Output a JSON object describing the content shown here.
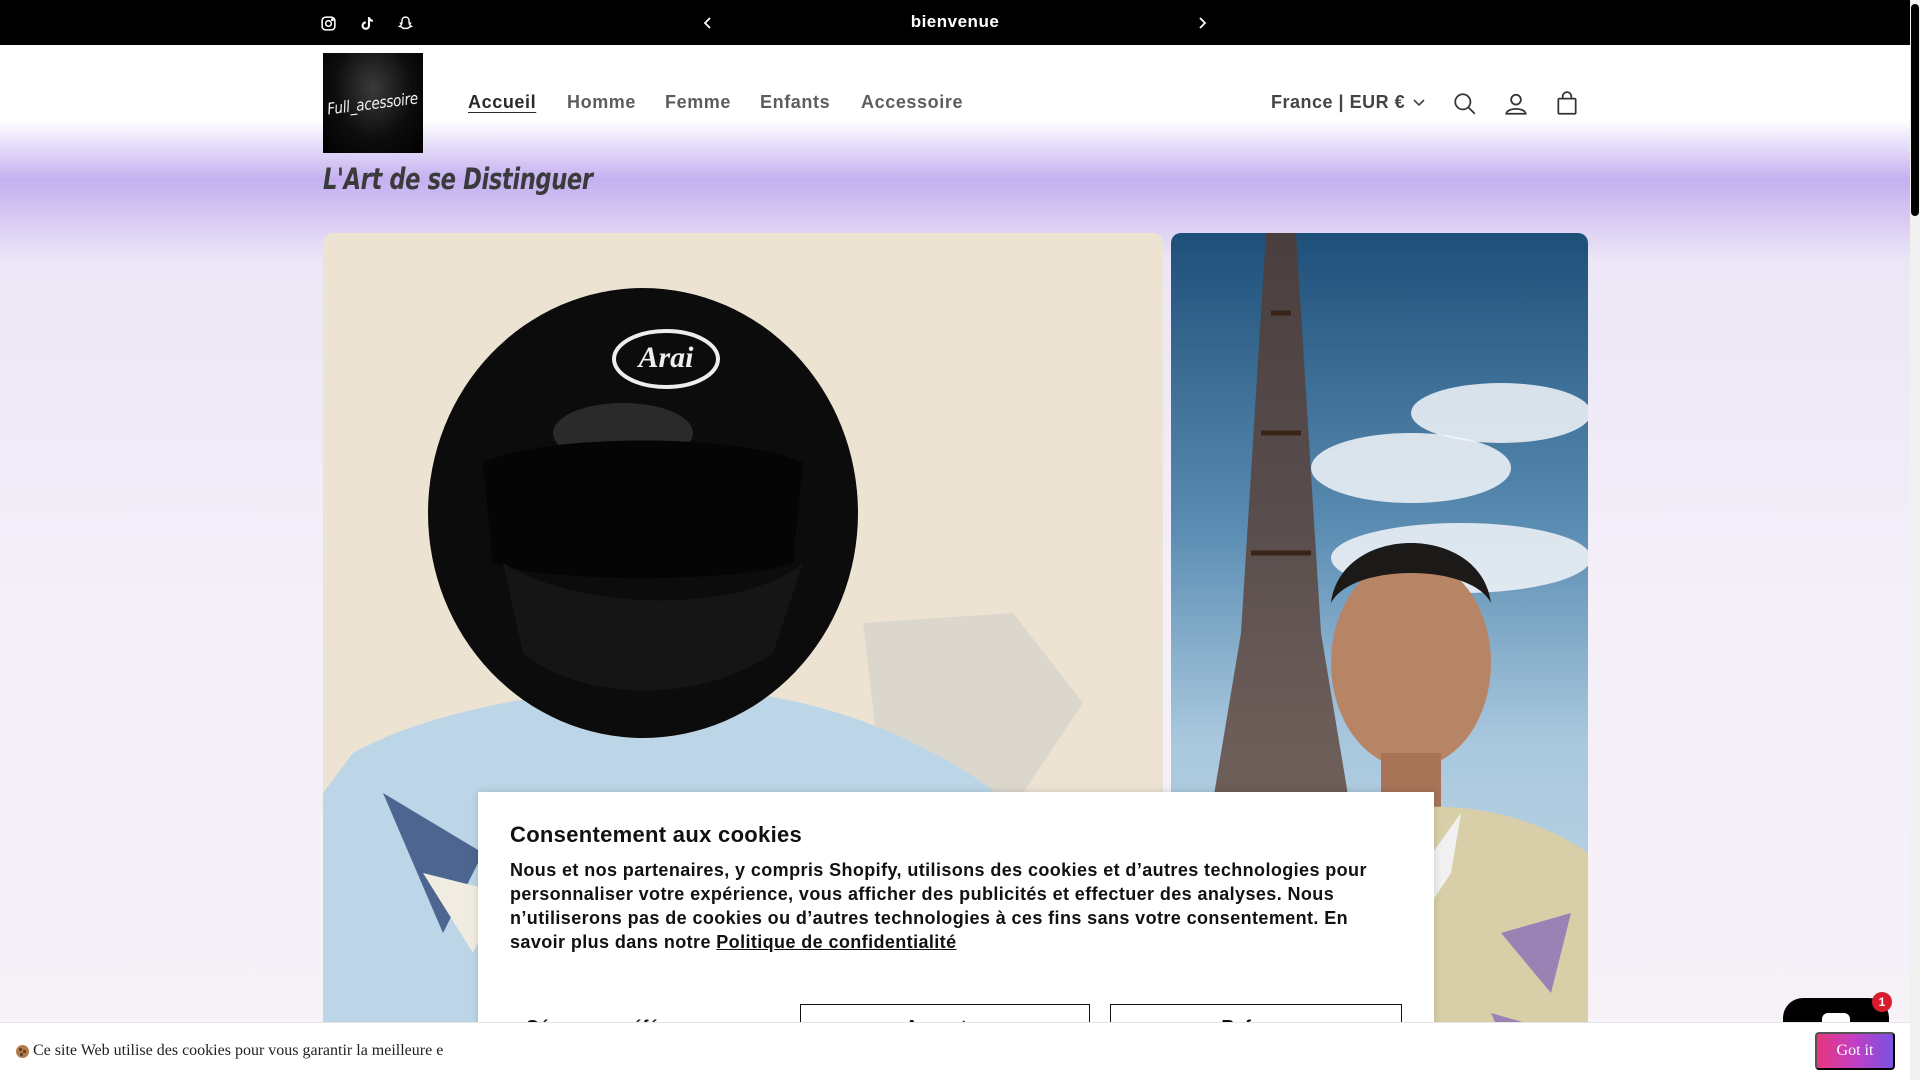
{
  "announcement": {
    "text": "bienvenue",
    "social_icons": [
      "instagram-icon",
      "tiktok-icon",
      "snapchat-icon"
    ]
  },
  "header": {
    "logo_text": "Full_acessoire",
    "nav": [
      {
        "label": "Accueil",
        "active": true
      },
      {
        "label": "Homme",
        "active": false
      },
      {
        "label": "Femme",
        "active": false
      },
      {
        "label": "Enfants",
        "active": false
      },
      {
        "label": "Accessoire",
        "active": false
      }
    ],
    "country": "France | EUR €",
    "icons": [
      "search-icon",
      "account-icon",
      "cart-icon"
    ]
  },
  "hero": {
    "tagline": "L'Art de se Distinguer"
  },
  "cookie_modal": {
    "title": "Consentement aux cookies",
    "body": "Nous et nos partenaires, y compris Shopify, utilisons des cookies et d’autres technologies pour personnaliser votre expérience, vous afficher des publicités et effectuer des analyses. Nous n’utiliserons pas de cookies ou d’autres technologies à ces fins sans votre consentement. En savoir plus dans notre ",
    "privacy_link": "Politique de confidentialité",
    "prefs_label": "Gérer vos préférences",
    "accept_label": "Accepter",
    "refuse_label": "Refuser"
  },
  "cookie_bar": {
    "text": "Ce site Web utilise des cookies pour vous garantir la meilleure e",
    "button": "Got it"
  },
  "chat": {
    "badge_count": "1"
  },
  "colors": {
    "announcement_bg": "#000000",
    "accent_gradient": [
      "#e8367b",
      "#7a52e0"
    ],
    "badge": "#d91d2e"
  }
}
